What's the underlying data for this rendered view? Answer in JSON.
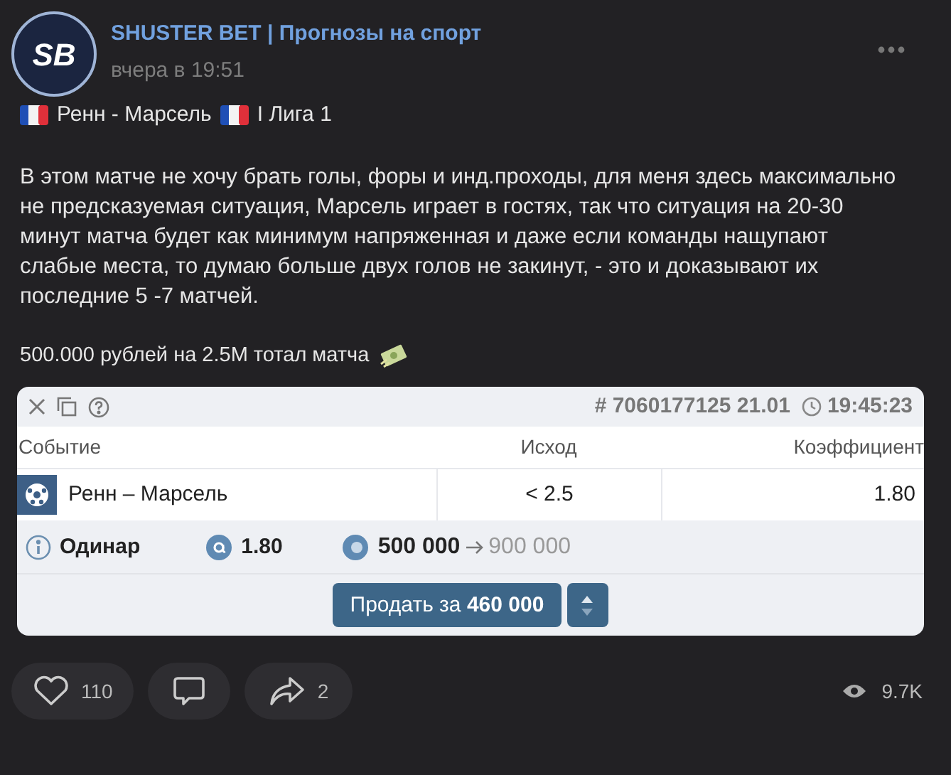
{
  "post": {
    "channel": "SHUSTER BET | Прогнозы на спорт",
    "time": "вчера в 19:51",
    "avatar_text": "SB",
    "headline": [
      {
        "kind": "flag"
      },
      {
        "kind": "text",
        "text": "Ренн - Марсель"
      },
      {
        "kind": "flag"
      },
      {
        "kind": "text",
        "text": "I Лига 1"
      }
    ],
    "body": "В этом матче не хочу брать голы, форы и инд.проходы, для меня здесь максимально не предсказуемая ситуация, Марсель играет в гостях, так что ситуация на 20-30 минут матча будет как минимум напряженная и даже если команды нащупают слабые места, то думаю больше двух голов не закинут, - это и доказывают их последние 5 -7 матчей.",
    "stake_line": "500.000 рублей на 2.5M тотал матча"
  },
  "bet_card": {
    "ticket": "# 7060177125 21.01",
    "clock": "19:45:23",
    "columns": [
      "Событие",
      "Исход",
      "Коэффициент"
    ],
    "rows": [
      {
        "event": "Ренн – Марсель",
        "outcome": "< 2.5",
        "odds": "1.80"
      }
    ],
    "type": "Одинар",
    "total_odds": "1.80",
    "stake": "500 000",
    "payout": "900 000",
    "sell_label": "Продать за",
    "sell_amount": "460 000"
  },
  "reactions": {
    "likes": "110",
    "shares": "2",
    "views": "9.7K"
  }
}
